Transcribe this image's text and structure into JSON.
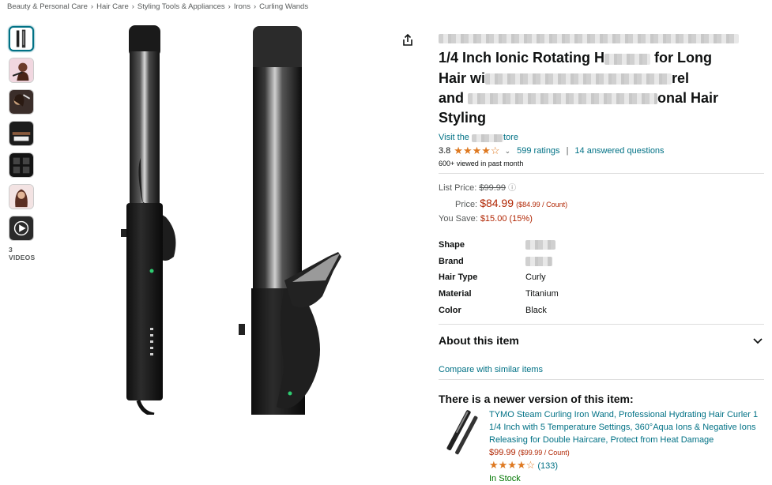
{
  "breadcrumb": [
    "Beauty & Personal Care",
    "Hair Care",
    "Styling Tools & Appliances",
    "Irons",
    "Curling Wands"
  ],
  "breadcrumb_sep": "›",
  "gallery": {
    "videos_label": "3 VIDEOS"
  },
  "product": {
    "title_line2_a": "1/4 Inch Ionic Rotating H",
    "title_line2_b": "for Long",
    "title_line3_a": "Hair wi",
    "title_line3_b": "rel",
    "title_line4_a": "and",
    "title_line4_b": "onal Hair",
    "title_line5": "Styling",
    "store_prefix": "Visit the",
    "store_suffix": "tore",
    "rating": "3.8",
    "stars": "★★★★☆",
    "ratings_link": "599 ratings",
    "questions_link": "14 answered questions",
    "viewed": "600+ viewed in past month"
  },
  "pricing": {
    "list_label": "List Price:",
    "list_value": "$99.99",
    "price_label": "Price:",
    "price_value": "$84.99",
    "price_unit": "($84.99 / Count)",
    "save_label": "You Save:",
    "save_value": "$15.00 (15%)"
  },
  "specs": [
    {
      "k": "Shape",
      "v": ""
    },
    {
      "k": "Brand",
      "v": ""
    },
    {
      "k": "Hair Type",
      "v": "Curly"
    },
    {
      "k": "Material",
      "v": "Titanium"
    },
    {
      "k": "Color",
      "v": "Black"
    }
  ],
  "about_label": "About this item",
  "compare_label": "Compare with similar items",
  "newer": {
    "heading": "There is a newer version of this item:",
    "title": "TYMO Steam Curling Iron Wand, Professional Hydrating Hair Curler 1 1/4 Inch with 5 Temperature Settings, 360°Aqua Ions & Negative Ions Releasing for Double Haircare, Protect from Heat Damage",
    "price": "$99.99",
    "unit": "($99.99 / Count)",
    "stars": "★★★★☆",
    "count": "(133)",
    "stock": "In Stock"
  },
  "colors": {
    "link": "#007185",
    "price": "#b12704",
    "star": "#de7921",
    "stock": "#007600"
  }
}
